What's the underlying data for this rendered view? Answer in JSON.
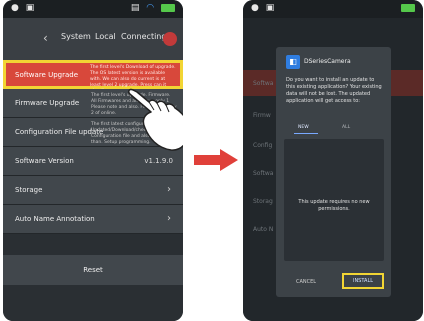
{
  "left_phone": {
    "tabs": [
      "System",
      "Local",
      "Connecting"
    ],
    "rows": [
      {
        "label": "Software Upgrade",
        "desc": "The first level's Download of upgrade. The OS latest version is available with. We can also do current is at least level 2 upgrade. Press can it also like.",
        "value": ""
      },
      {
        "label": "Firmware Upgrade",
        "desc": "The first level's upgrade. Firmware. All Firmwares and also have only 1 Please note and also. Firmware. Apply 2 of online.",
        "value": ""
      },
      {
        "label": "Configuration File update",
        "desc": "The first latest configuration file is Updated/Download/check. Configuration file and also here and than. Setup programming.",
        "value": ""
      },
      {
        "label": "Software Version",
        "desc": "",
        "value": "v1.1.9.0"
      },
      {
        "label": "Storage",
        "desc": "",
        "value": ""
      },
      {
        "label": "Auto Name Annotation",
        "desc": "",
        "value": ""
      }
    ],
    "reset_label": "Reset"
  },
  "right_phone": {
    "bg_rows": [
      "Softwa",
      "Firmw",
      "Config",
      "Softwa",
      "Storag",
      "Auto N"
    ],
    "dialog": {
      "app_name": "DSeriesCamera",
      "prompt": "Do you want to install an update to this existing application? Your existing data will not be lost. The updated application will get access to:",
      "tab_new": "NEW",
      "tab_all": "ALL",
      "permission_text": "This update requires no new permissions.",
      "cancel_label": "CANCEL",
      "install_label": "INSTALL"
    }
  },
  "colors": {
    "highlight_red": "#d8483b",
    "highlight_border": "#f2d534",
    "arrow_red": "#e0403a"
  }
}
